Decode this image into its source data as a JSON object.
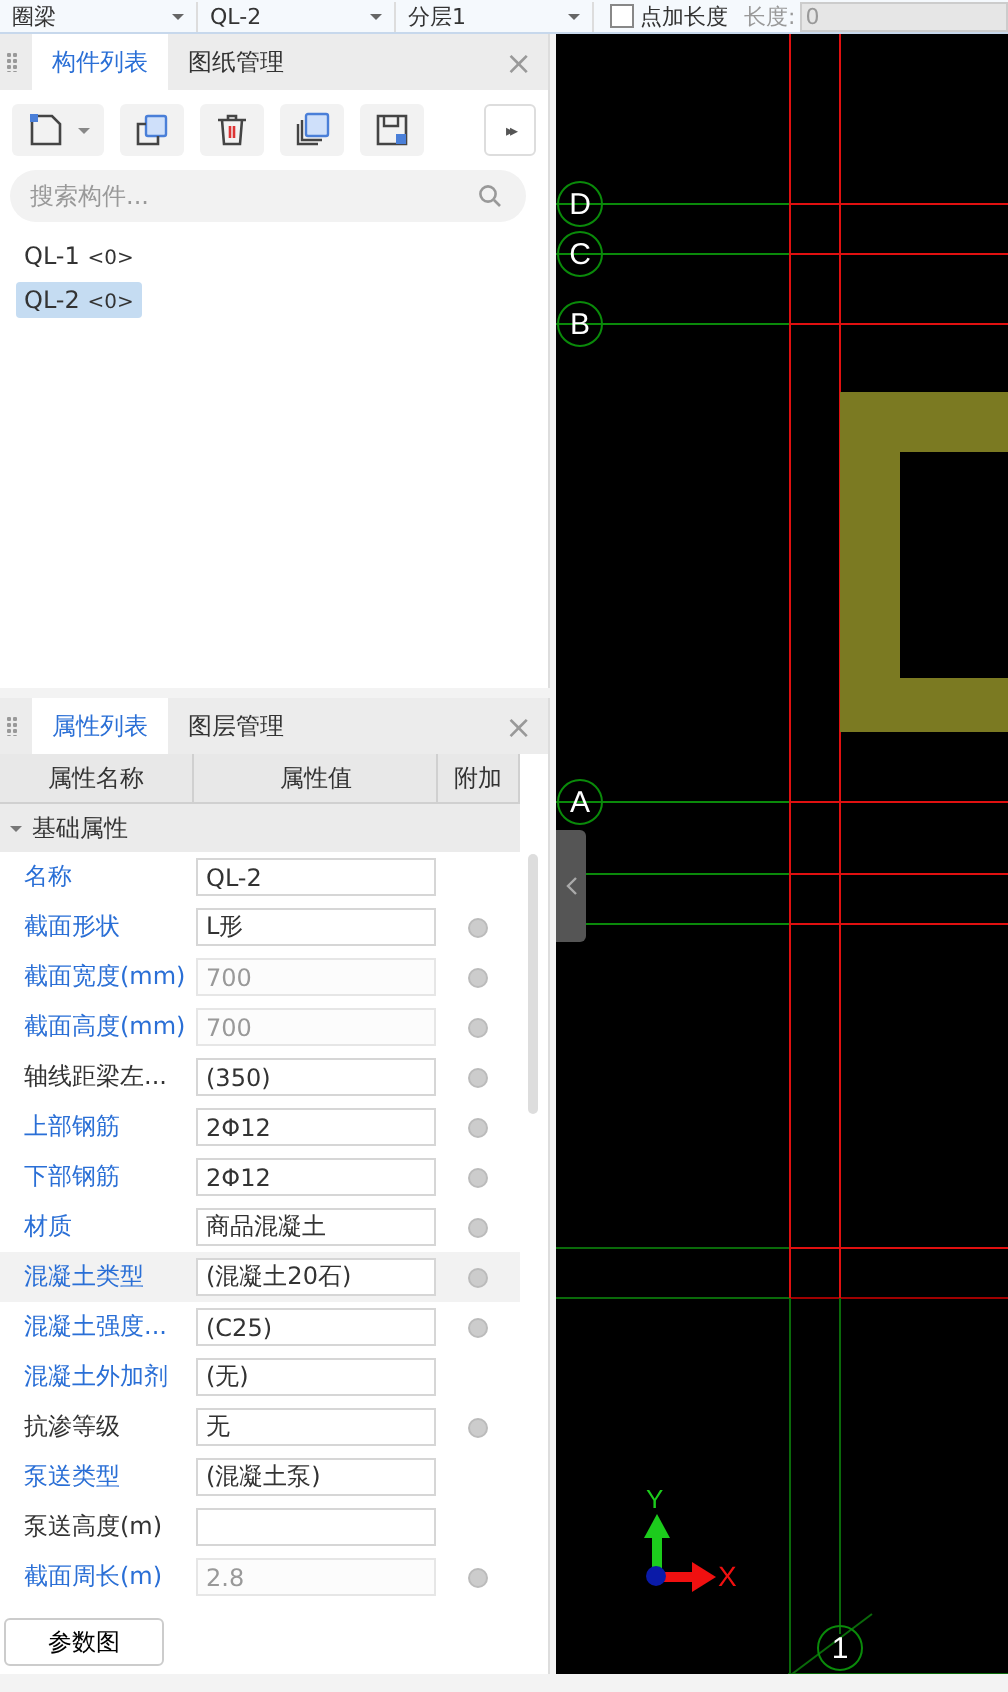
{
  "toolbar": {
    "dropdowns": [
      "圈梁",
      "QL-2",
      "分层1"
    ],
    "checkbox": {
      "label": "点加长度",
      "checked": false
    },
    "length": {
      "label": "长度:",
      "value": "0"
    }
  },
  "component_panel": {
    "tabs": [
      {
        "label": "构件列表",
        "selected": true
      },
      {
        "label": "图纸管理",
        "selected": false
      }
    ],
    "close": "×",
    "more": "▸▸",
    "search": {
      "placeholder": "搜索构件..."
    },
    "items": [
      {
        "name": "QL-1",
        "count": "<0>",
        "selected": false
      },
      {
        "name": "QL-2",
        "count": "<0>",
        "selected": true
      }
    ]
  },
  "property_panel": {
    "tabs": [
      {
        "label": "属性列表",
        "selected": true
      },
      {
        "label": "图层管理",
        "selected": false
      }
    ],
    "close": "×",
    "columns": [
      "属性名称",
      "属性值",
      "附加"
    ],
    "group": {
      "label": "基础属性",
      "expanded": true
    },
    "rows": [
      {
        "name": "名称",
        "value": "QL-2",
        "link": true,
        "disabled": false,
        "dot": false,
        "selected": false
      },
      {
        "name": "截面形状",
        "value": "L形",
        "link": true,
        "disabled": false,
        "dot": true,
        "selected": false
      },
      {
        "name": "截面宽度(mm)",
        "value": "700",
        "link": true,
        "disabled": true,
        "dot": true,
        "selected": false
      },
      {
        "name": "截面高度(mm)",
        "value": "700",
        "link": true,
        "disabled": true,
        "dot": true,
        "selected": false
      },
      {
        "name": "轴线距梁左...",
        "value": "(350)",
        "link": false,
        "disabled": false,
        "dot": true,
        "selected": false
      },
      {
        "name": "上部钢筋",
        "value": "2Φ12",
        "link": true,
        "disabled": false,
        "dot": true,
        "selected": false
      },
      {
        "name": "下部钢筋",
        "value": "2Φ12",
        "link": true,
        "disabled": false,
        "dot": true,
        "selected": false
      },
      {
        "name": "材质",
        "value": "商品混凝土",
        "link": true,
        "disabled": false,
        "dot": true,
        "selected": false
      },
      {
        "name": "混凝土类型",
        "value": "(混凝土20石)",
        "link": true,
        "disabled": false,
        "dot": true,
        "selected": true
      },
      {
        "name": "混凝土强度...",
        "value": "(C25)",
        "link": true,
        "disabled": false,
        "dot": true,
        "selected": false
      },
      {
        "name": "混凝土外加剂",
        "value": "(无)",
        "link": true,
        "disabled": false,
        "dot": false,
        "selected": false
      },
      {
        "name": "抗渗等级",
        "value": "无",
        "link": false,
        "disabled": false,
        "dot": true,
        "selected": false
      },
      {
        "name": "泵送类型",
        "value": "(混凝土泵)",
        "link": true,
        "disabled": false,
        "dot": false,
        "selected": false
      },
      {
        "name": "泵送高度(m)",
        "value": "",
        "link": false,
        "disabled": false,
        "dot": false,
        "selected": false
      },
      {
        "name": "截面周长(m)",
        "value": "2.8",
        "link": true,
        "disabled": true,
        "dot": true,
        "selected": false
      }
    ],
    "button": "参数图"
  },
  "canvas": {
    "axis_labels": [
      {
        "label": "D",
        "kind": "row"
      },
      {
        "label": "C",
        "kind": "row"
      },
      {
        "label": "B",
        "kind": "row"
      },
      {
        "label": "A",
        "kind": "row"
      },
      {
        "label": "1",
        "kind": "column"
      }
    ],
    "x_label": "X",
    "y_label": "Y"
  }
}
